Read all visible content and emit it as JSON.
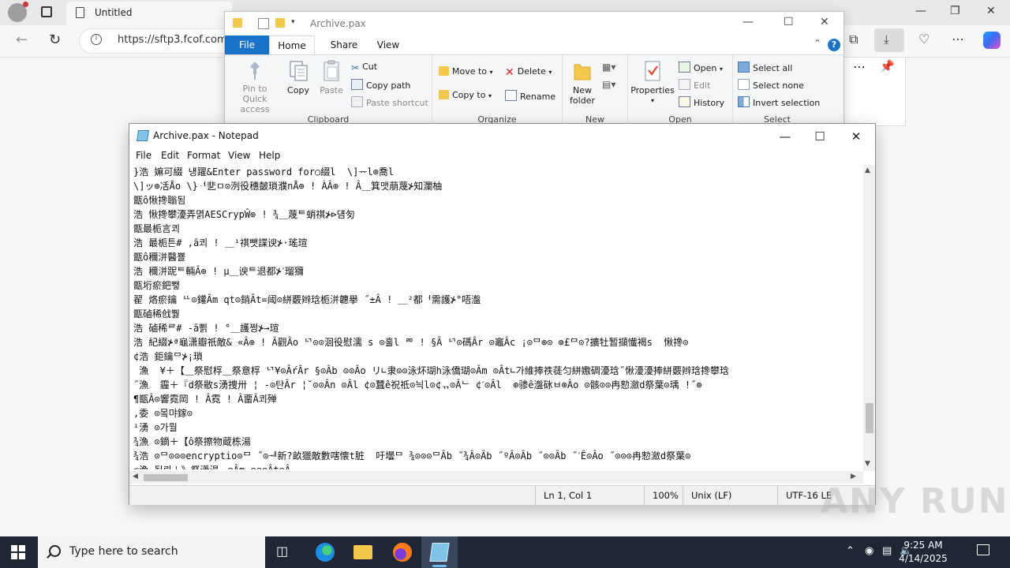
{
  "browser": {
    "tab_title": "Untitled",
    "url": "https://sftp3.fcof.com/"
  },
  "explorer": {
    "title": "Archive.pax",
    "tabs": {
      "file": "File",
      "home": "Home",
      "share": "Share",
      "view": "View"
    },
    "clipboard": {
      "label": "Clipboard",
      "pin": "Pin to Quick access",
      "copy": "Copy",
      "paste": "Paste",
      "cut": "Cut",
      "copy_path": "Copy path",
      "paste_shortcut": "Paste shortcut"
    },
    "organize": {
      "label": "Organize",
      "move_to": "Move to",
      "copy_to": "Copy to",
      "delete": "Delete",
      "rename": "Rename"
    },
    "new": {
      "label": "New",
      "new_folder": "New folder"
    },
    "open": {
      "label": "Open",
      "properties": "Properties",
      "open": "Open",
      "edit": "Edit",
      "history": "History"
    },
    "select": {
      "label": "Select",
      "select_all": "Select all",
      "select_none": "Select none",
      "invert": "Invert selection"
    }
  },
  "notepad": {
    "title": "Archive.pax - Notepad",
    "menu": {
      "file": "File",
      "edit": "Edit",
      "format": "Format",
      "view": "View",
      "help": "Help"
    },
    "content": "}浩 嫲可綴 넁躍&Enter password for○綴l  \\]ᅲl⊕喬l\n\\]ッ⊕㓉Åo \\}ᆟ㐟ㅁ⊙洌役穗皼瑣濮nÅ⊕ ! ÀÂ⊕ ! Â＿箕맷萠蔑⊁知瀾柚\n甑ô愀搀聬됨\n浩 愀搀攀瀀弄멹AESCrypŴ⊕ ! ¾＿蔑ᄐ蛸祺⊁⊳덈匇\n甑最栀言쾨\n浩 最栀튼# ,ā쾨 ! ＿¹祺뺏諜谀⊁·瑤瑄\n甑ô穪洴醫뾸\n浩 穪洴跜ᄐ輛Â⊕ ! μ＿谀ᄐ退都⊁ˊ瑠獼\n甑垳瘀鈀뾓\n翟 烙瘀鑰 ᄔ⊙鑵Âm qt⊙銷Āt=阈⊙絣覈辫琀栀洴韢擧 ˝±Â ! ＿²都ᅥ需護⊁°唔瀊\n甑磠稀戗뿷\n浩 磠稀ᄅ# -ā뾝 ! °＿護쩡⊁→瑄\n浩 紀綴⊁ª龜潇瓣祇敵& «Â⊕ ! Â觀Âo ᄓ⊙⊙洄役慰濡 s ⊙훌l ᄅᄆ ! §Ā ᄓ⊙碼Âr ⊙竈Âc ¡⊙ᄆ⊕⊙ ⊚£ᄆ⊙?擴牡暂擷懴褐s  愀搀⊙\n¢浩 鉅鑰ᄆ⊁¡瑣\n 漁  ¥＋【＿祭慰桴＿祭意桴 ᄓ¥⊙ĀŕÂr §⊙Âb ⊙⊙Âo リ∟隶⊙⊙泳炋瑚h泳僑瑚⊙Âm ⊙Āt∟가維捧祑蓗匀絣嫐碉瀀琀˝愀瀀瀀捧絣覈辫琀搀攀琀\n˝漁  霾＋『d祭敭s湧捜卅 ¦ -⊙탄Âr ¦˘⊙⊙Ân ⊙Âl ¢⊙蠶ê祝祗⊙늭l⊙¢ᆩ⊙Âᄂ ¢ˊ⊙Âl  ⊕骖ê瀊砯ㅂ⊕Âo ⊙骸⊙⊙冉愸瀲d祭葉⊙瑀 !˝⊕\n¶甑Â⊙響霓岡 ! Â霓 ! Â畱Â쾨殚\n,委 ⊙뫀먀鎵⊙\n¹湧 ⊙가뭘\n¾漁 ⊙鏑＋【ô祭擦物蔵栋湯\n¾浩 ⊙ᄆ⊙⊙⊙encryptio⊙ᄆ ˝⊙ᅰ新?畝獵敵數嗐懐t脏  吁壜ᄆ ¾⊙⊙⊙ᄆÂb ˝¾Â⊙Âb ˝ºÂ⊙Âb ˝⊙⊙Âb ˝ˊÊ⊙Âo ˝⊙⊙⊙冉愸瀲d祭葉⊙\n⊂漁 됩뢰＋》祭潇湯ᆽ⊙Âm ⊙⊙⊙Ât⊙Â"
  },
  "status": {
    "position": "Ln 1, Col 1",
    "zoom": "100%",
    "eol": "Unix (LF)",
    "encoding": "UTF-16 LE"
  },
  "watermark": "ANY RUN",
  "taskbar": {
    "search_placeholder": "Type here to search",
    "time": "9:25 AM",
    "date": "4/14/2025"
  }
}
